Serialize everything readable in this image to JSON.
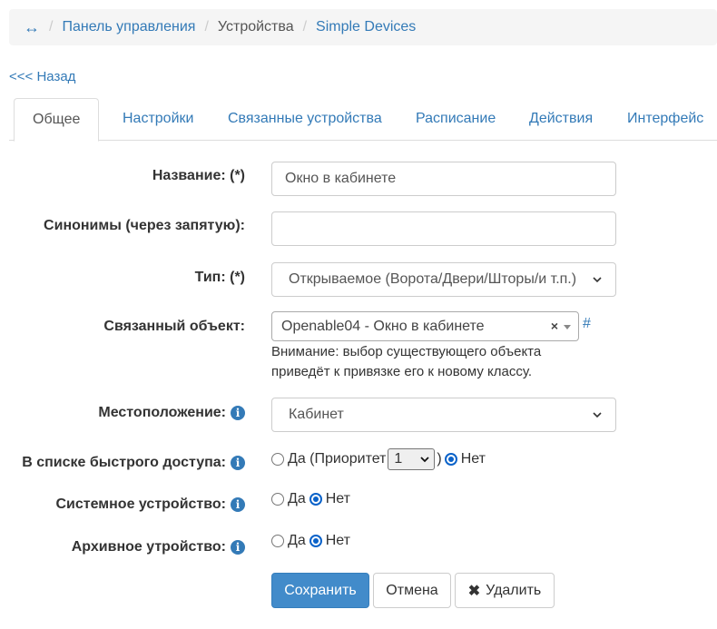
{
  "breadcrumb": {
    "home_icon": "↔",
    "items": [
      "Панель управления",
      "Устройства",
      "Simple Devices"
    ]
  },
  "back_link": "<<< Назад",
  "tabs": [
    {
      "label": "Общее",
      "active": true
    },
    {
      "label": "Настройки"
    },
    {
      "label": "Связанные устройства"
    },
    {
      "label": "Расписание"
    },
    {
      "label": "Действия"
    },
    {
      "label": "Интерфейс"
    }
  ],
  "form": {
    "name_label": "Название: (*)",
    "name_value": "Окно в кабинете",
    "synonyms_label": "Синонимы (через запятую):",
    "synonyms_value": "",
    "type_label": "Тип: (*)",
    "type_value": "Открываемое (Ворота/Двери/Шторы/и т.п.)",
    "linked_object_label": "Связанный объект:",
    "linked_object_value": "Openable04 - Окно в кабинете",
    "linked_object_clear": "×",
    "linked_object_hash": "#",
    "linked_object_warning": "Внимание: выбор существующего объекта приведёт к привязке его к новому классу.",
    "location_label": "Местоположение:",
    "location_value": "Кабинет",
    "quick_access_label": "В списке быстрого доступа:",
    "quick_access_yes": "Да (Приоритет",
    "quick_access_priority": "1",
    "quick_access_close": ")",
    "quick_access_no": "Нет",
    "quick_access_selected": "no",
    "system_device_label": "Системное устройство:",
    "system_device_yes": "Да",
    "system_device_no": "Нет",
    "system_device_selected": "no",
    "archive_label": "Архивное утройство:",
    "archive_yes": "Да",
    "archive_no": "Нет",
    "archive_selected": "no",
    "info_icon": "i"
  },
  "buttons": {
    "save": "Сохранить",
    "cancel": "Отмена",
    "delete_icon": "✖",
    "delete": "Удалить"
  },
  "colors": {
    "link": "#337ab7",
    "primary": "#428bca",
    "radio_checked": "#0a62c9"
  }
}
